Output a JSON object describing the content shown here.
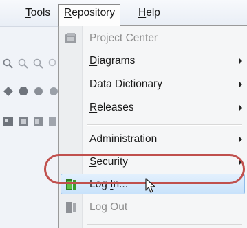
{
  "menubar": {
    "tools_prefix": "",
    "tools_key": "T",
    "tools_rest": "ools",
    "repository_key": "R",
    "repository_rest": "epository",
    "help_key": "H",
    "help_rest": "elp"
  },
  "menu": {
    "items": [
      {
        "pre": "Project ",
        "key": "C",
        "post": "enter",
        "disabled": true,
        "icon": "project-center-icon"
      },
      {
        "pre": "",
        "key": "D",
        "post": "iagrams",
        "submenu": true
      },
      {
        "pre": "D",
        "key": "a",
        "post": "ta Dictionary",
        "submenu": true
      },
      {
        "pre": "",
        "key": "R",
        "post": "eleases",
        "submenu": true
      },
      {
        "pre": "Ad",
        "key": "m",
        "post": "inistration",
        "submenu": true
      },
      {
        "pre": "",
        "key": "S",
        "post": "ecurity",
        "submenu": true
      },
      {
        "pre": "Log ",
        "key": "I",
        "post": "n...",
        "highlighted": true,
        "icon": "log-in-icon"
      },
      {
        "pre": "Log Ou",
        "key": "t",
        "post": "",
        "disabled": true,
        "icon": "log-out-icon"
      }
    ]
  },
  "colors": {
    "callout": "#c0504d",
    "highlight": "#c8e2fb",
    "login_icon": "#3c9a2f"
  }
}
